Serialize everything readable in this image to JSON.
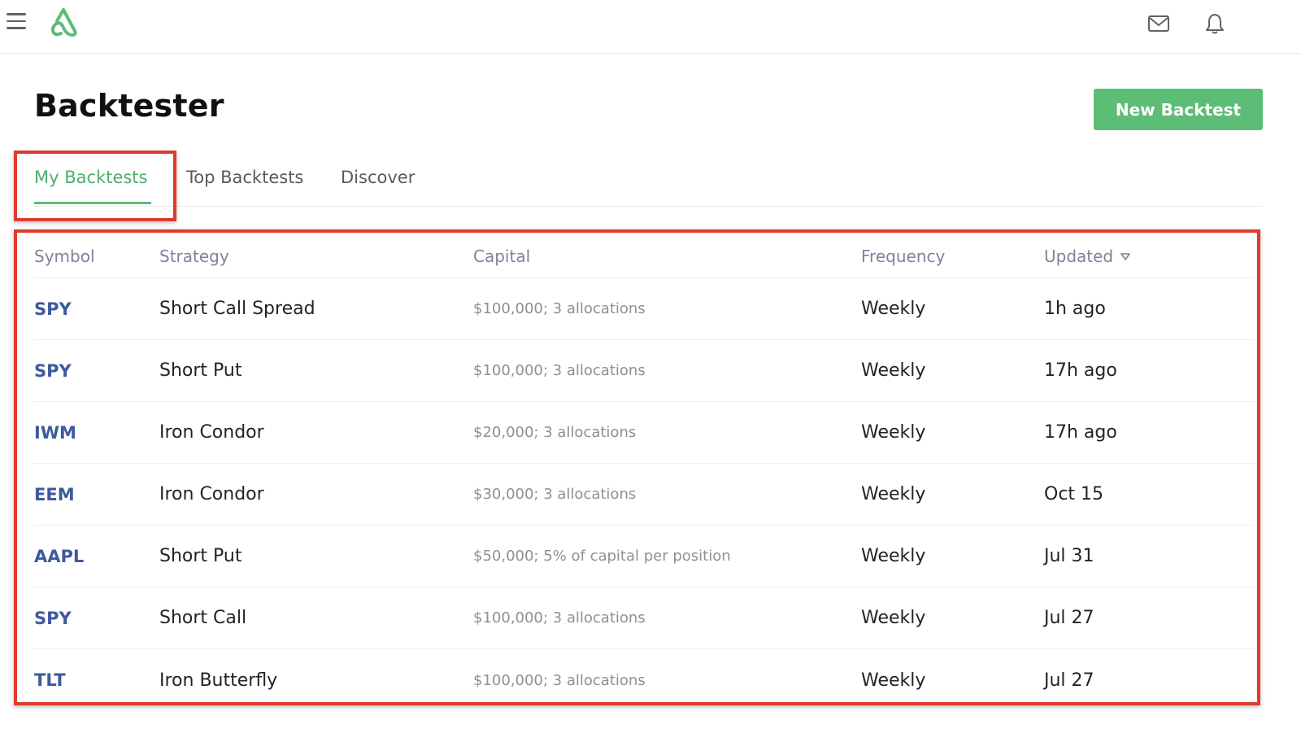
{
  "header": {
    "menu_icon": "hamburger-menu-icon",
    "logo_icon": "brand-logo-icon",
    "mail_icon": "mail-icon",
    "bell_icon": "bell-icon",
    "brand_color": "#5cbd76"
  },
  "page": {
    "title": "Backtester",
    "new_button_label": "New Backtest"
  },
  "tabs": [
    {
      "label": "My Backtests",
      "active": true
    },
    {
      "label": "Top Backtests",
      "active": false
    },
    {
      "label": "Discover",
      "active": false
    }
  ],
  "table": {
    "columns": {
      "symbol": "Symbol",
      "strategy": "Strategy",
      "capital": "Capital",
      "frequency": "Frequency",
      "updated": "Updated"
    },
    "sort_icon": "sort-desc-icon",
    "rows": [
      {
        "symbol": "SPY",
        "strategy": "Short Call Spread",
        "capital": "$100,000; 3 allocations",
        "frequency": "Weekly",
        "updated": "1h ago"
      },
      {
        "symbol": "SPY",
        "strategy": "Short Put",
        "capital": "$100,000; 3 allocations",
        "frequency": "Weekly",
        "updated": "17h ago"
      },
      {
        "symbol": "IWM",
        "strategy": "Iron Condor",
        "capital": "$20,000; 3 allocations",
        "frequency": "Weekly",
        "updated": "17h ago"
      },
      {
        "symbol": "EEM",
        "strategy": "Iron Condor",
        "capital": "$30,000; 3 allocations",
        "frequency": "Weekly",
        "updated": "Oct 15"
      },
      {
        "symbol": "AAPL",
        "strategy": "Short Put",
        "capital": "$50,000; 5% of capital per position",
        "frequency": "Weekly",
        "updated": "Jul 31"
      },
      {
        "symbol": "SPY",
        "strategy": "Short Call",
        "capital": "$100,000; 3 allocations",
        "frequency": "Weekly",
        "updated": "Jul 27"
      },
      {
        "symbol": "TLT",
        "strategy": "Iron Butterfly",
        "capital": "$100,000; 3 allocations",
        "frequency": "Weekly",
        "updated": "Jul 27"
      }
    ]
  }
}
